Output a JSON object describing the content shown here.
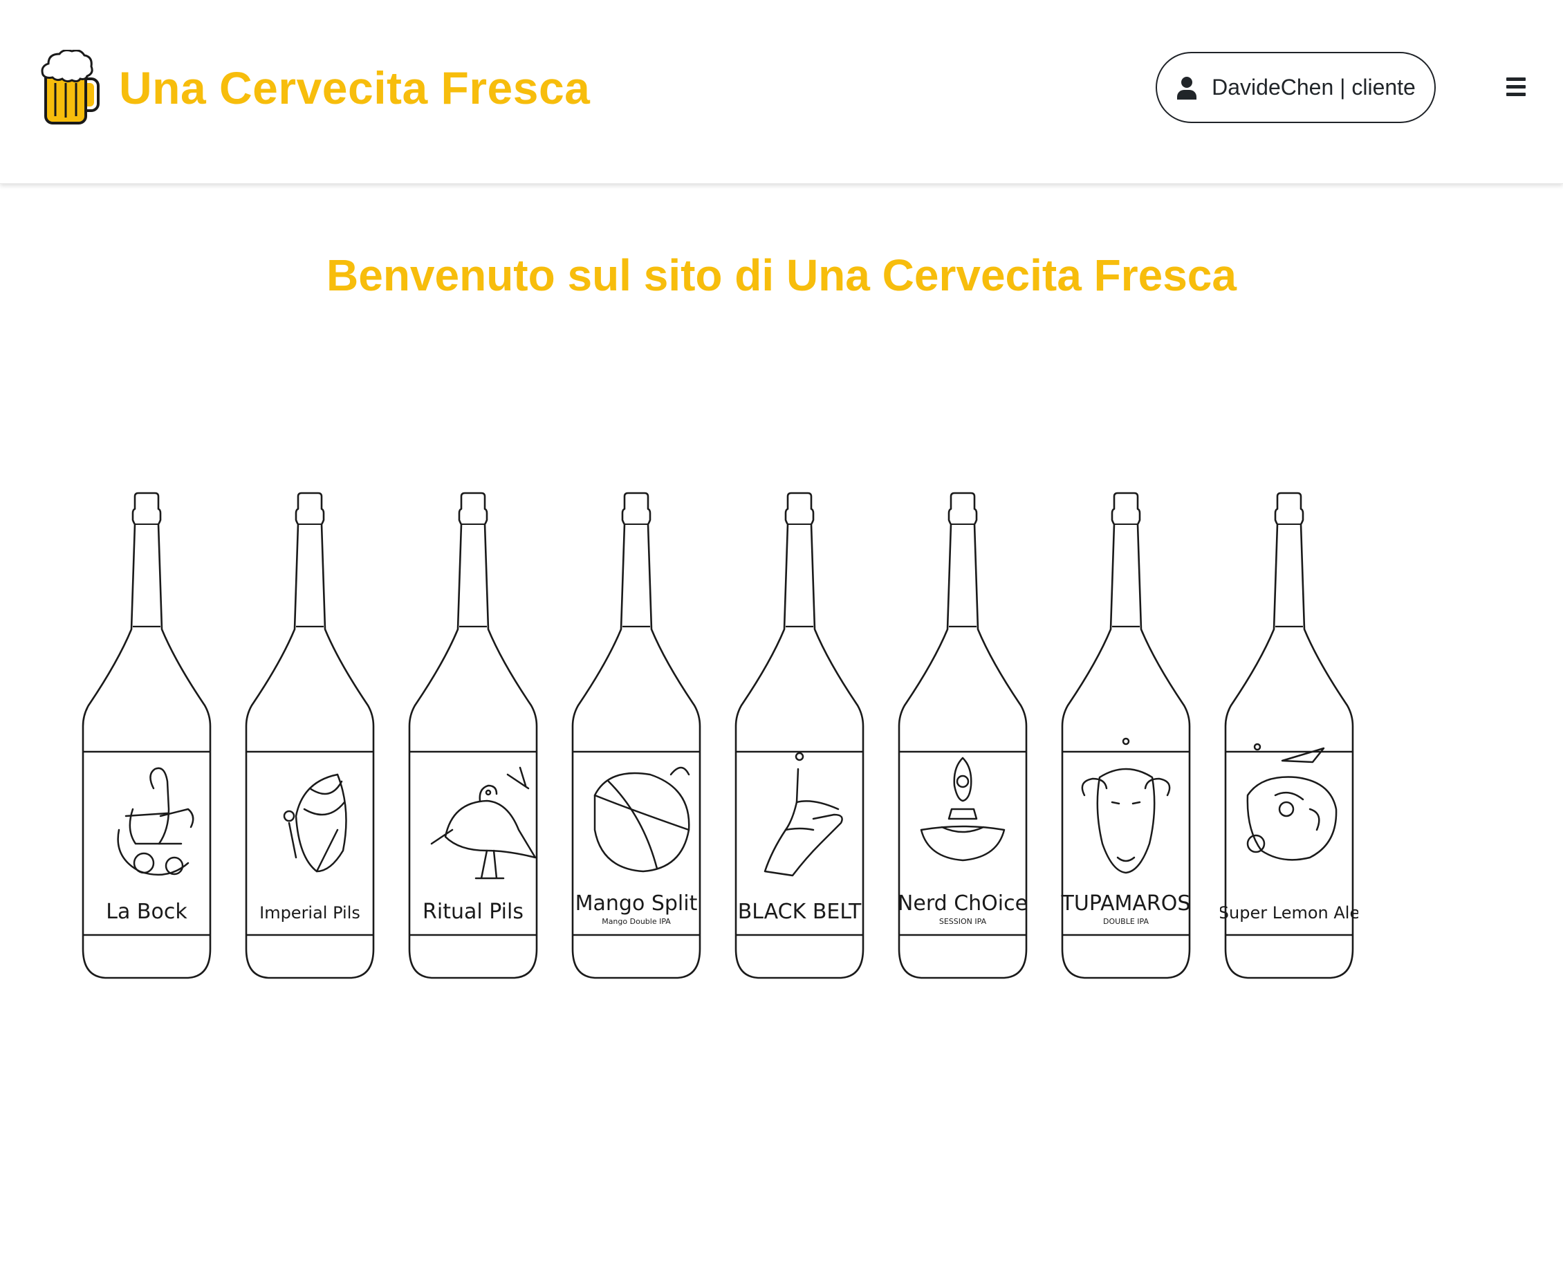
{
  "header": {
    "brand_name": "Una Cervecita Fresca",
    "brand_logo_icon": "beer-mug-icon",
    "brand_color": "#f7bd0c",
    "user": {
      "icon": "user-icon",
      "name": "DavideChen",
      "separator": "|",
      "role": "cliente",
      "display": "DavideChen | cliente"
    },
    "menu_icon": "hamburger-menu-icon"
  },
  "main": {
    "welcome_title": "Benvenuto sul sito di Una Cervecita Fresca",
    "bottles": [
      {
        "name": "La Bock",
        "subtitle": "",
        "illustration": "rocking-chair-icon"
      },
      {
        "name": "Imperial Pils",
        "subtitle": "",
        "illustration": "abstract-shell-icon"
      },
      {
        "name": "Ritual Pils",
        "subtitle": "",
        "illustration": "bird-icon"
      },
      {
        "name": "Mango Split",
        "subtitle": "Mango Double IPA",
        "illustration": "mango-icon"
      },
      {
        "name": "BLACK BELT",
        "subtitle": "",
        "illustration": "hand-icon"
      },
      {
        "name": "Nerd ChOice",
        "subtitle": "SESSION IPA",
        "illustration": "oil-lamp-icon"
      },
      {
        "name": "TUPAMAROS",
        "subtitle": "DOUBLE IPA",
        "illustration": "sheep-icon"
      },
      {
        "name": "Super Lemon Ale",
        "subtitle": "",
        "illustration": "abstract-face-icon"
      }
    ]
  }
}
